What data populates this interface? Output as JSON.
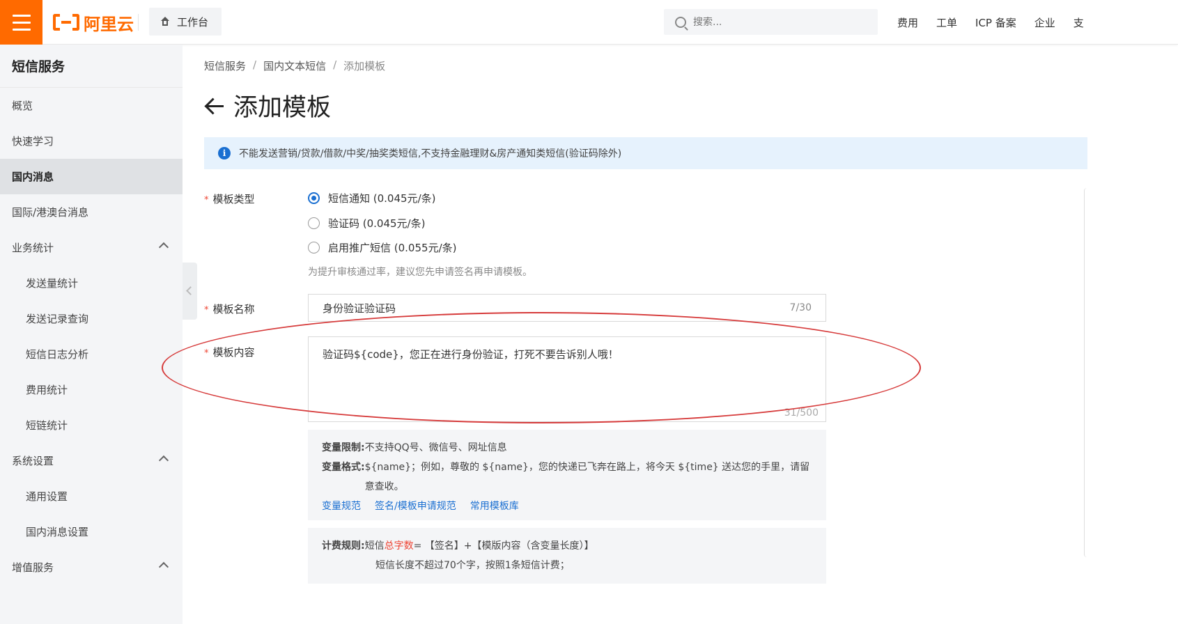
{
  "topbar": {
    "logo_text": "阿里云",
    "workbench": "工作台",
    "search_placeholder": "搜索...",
    "links": [
      "费用",
      "工单",
      "ICP 备案",
      "企业",
      "支"
    ]
  },
  "sidebar": {
    "title": "短信服务",
    "items": [
      {
        "label": "概览"
      },
      {
        "label": "快速学习"
      },
      {
        "label": "国内消息"
      },
      {
        "label": "国际/港澳台消息"
      },
      {
        "label": "业务统计"
      },
      {
        "label": "发送量统计"
      },
      {
        "label": "发送记录查询"
      },
      {
        "label": "短信日志分析"
      },
      {
        "label": "费用统计"
      },
      {
        "label": "短链统计"
      },
      {
        "label": "系统设置"
      },
      {
        "label": "通用设置"
      },
      {
        "label": "国内消息设置"
      },
      {
        "label": "增值服务"
      }
    ]
  },
  "breadcrumb": [
    "短信服务",
    "国内文本短信",
    "添加模板"
  ],
  "page": {
    "title": "添加模板",
    "notice": "不能发送营销/贷款/借款/中奖/抽奖类短信,不支持金融理财&房产通知类短信(验证码除外)"
  },
  "form": {
    "type_label": "模板类型",
    "type_options": [
      "短信通知 (0.045元/条)",
      "验证码 (0.045元/条)",
      "启用推广短信 (0.055元/条)"
    ],
    "type_hint": "为提升审核通过率，建议您先申请签名再申请模板。",
    "name_label": "模板名称",
    "name_value": "身份验证验证码",
    "name_count": "7/30",
    "content_label": "模板内容",
    "content_value": "验证码${code}，您正在进行身份验证，打死不要告诉别人哦！",
    "content_count": "31/500"
  },
  "tips": {
    "limit_key": "变量限制:",
    "limit_val": "不支持QQ号、微信号、网址信息",
    "format_key": "变量格式:",
    "format_val": "${name}；例如，尊敬的 ${name}，您的快递已飞奔在路上，将今天 ${time} 送达您的手里，请留意查收。",
    "links": [
      "变量规范",
      "签名/模板申请规范",
      "常用模板库"
    ]
  },
  "fee": {
    "key": "计费规则:",
    "rule_prefix": "短信",
    "rule_highlight": "总字数",
    "rule_suffix": " = 【签名】+【模版内容（含变量长度）】",
    "line2": "短信长度不超过70个字，按照1条短信计费；"
  },
  "colors": {
    "accent": "#ff6a00",
    "link": "#1a6fd1",
    "annotation": "#d63a3a"
  }
}
